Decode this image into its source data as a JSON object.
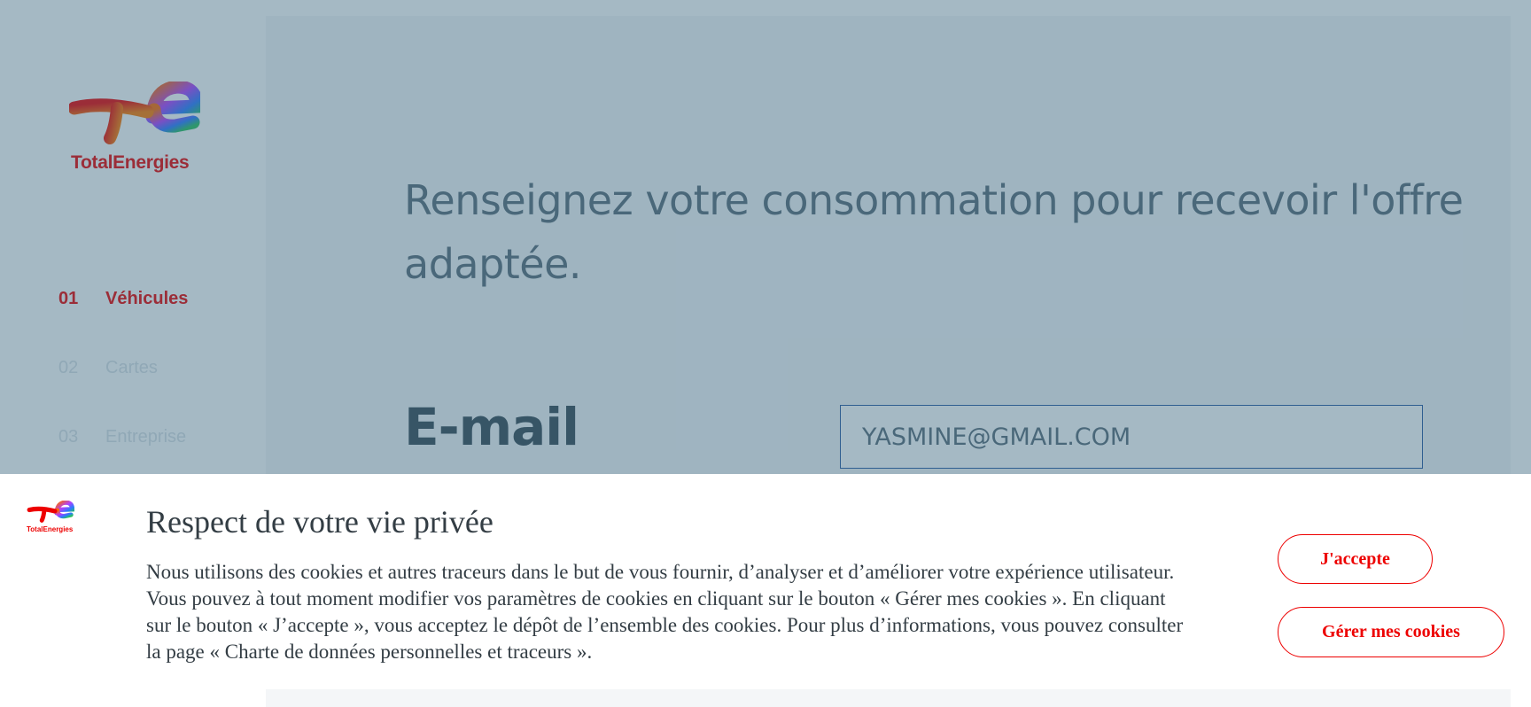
{
  "brand": {
    "name": "TotalEnergies",
    "accent_color": "#ed0000"
  },
  "sidebar": {
    "steps": [
      {
        "num": "01",
        "label": "Véhicules",
        "active": true
      },
      {
        "num": "02",
        "label": "Cartes",
        "active": false
      },
      {
        "num": "03",
        "label": "Entreprise",
        "active": false
      }
    ]
  },
  "main": {
    "headline": "Renseignez votre consommation pour recevoir l'offre adaptée.",
    "email_label": "E-mail",
    "email_value": "YASMINE@GMAIL.COM"
  },
  "cookie_banner": {
    "title": "Respect de votre vie privée",
    "text": "Nous utilisons des cookies et autres traceurs dans le but de vous fournir, d’analyser et d’améliorer votre expérience utilisateur. Vous pouvez à tout moment modifier vos paramètres de cookies en cliquant sur le bouton « Gérer mes cookies ». En cliquant sur le bouton « J’accepte », vous acceptez le dépôt de l’ensemble des cookies. Pour plus d’informations, vous pouvez consulter la page « Charte de données personnelles et traceurs ».",
    "accept_label": "J'accepte",
    "manage_label": "Gérer mes cookies"
  }
}
